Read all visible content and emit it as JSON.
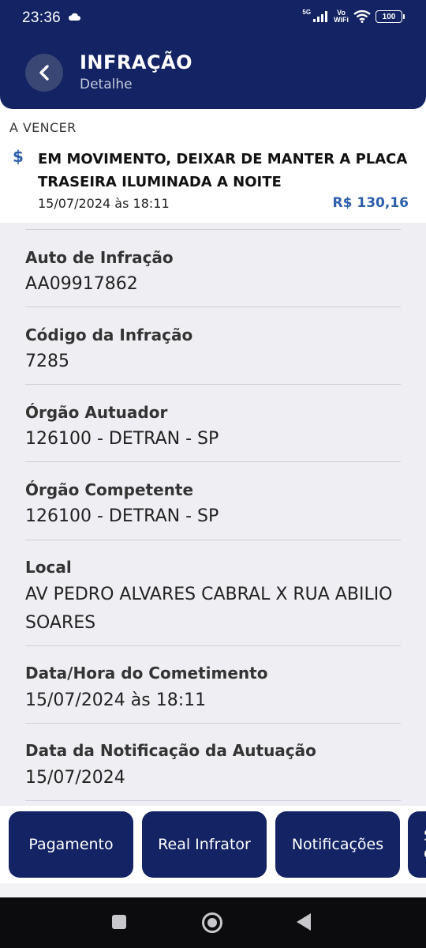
{
  "status_bar": {
    "time": "23:36",
    "network": "5G",
    "vowifi_top": "Vo",
    "vowifi_bottom": "WiFi",
    "battery": "100"
  },
  "header": {
    "title": "INFRAÇÃO",
    "subtitle": "Detalhe"
  },
  "summary": {
    "status": "A VENCER",
    "description": "EM MOVIMENTO, DEIXAR DE MANTER A PLACA TRASEIRA ILUMINADA A NOITE",
    "datetime": "15/07/2024 às 18:11",
    "amount": "R$ 130,16",
    "icon_glyph": "$"
  },
  "details": [
    {
      "label": "Auto de Infração",
      "value": "AA09917862"
    },
    {
      "label": "Código da Infração",
      "value": "7285"
    },
    {
      "label": "Órgão Autuador",
      "value": "126100 - DETRAN - SP"
    },
    {
      "label": "Órgão Competente",
      "value": "126100 - DETRAN - SP"
    },
    {
      "label": "Local",
      "value": "AV PEDRO ALVARES CABRAL X RUA ABILIO SOARES"
    },
    {
      "label": "Data/Hora do Cometimento",
      "value": "15/07/2024 às 18:11"
    },
    {
      "label": "Data da Notificação da Autuação",
      "value": "15/07/2024"
    }
  ],
  "actions": [
    {
      "label": "Pagamento"
    },
    {
      "label": "Real Infrator"
    },
    {
      "label": "Notificações"
    },
    {
      "label": "S\nc"
    }
  ],
  "colors": {
    "primary": "#132363",
    "accent": "#2d5fab",
    "background": "#efeef3"
  },
  "icons": {
    "back": "chevron-left-icon",
    "payment": "dollar-icon"
  }
}
